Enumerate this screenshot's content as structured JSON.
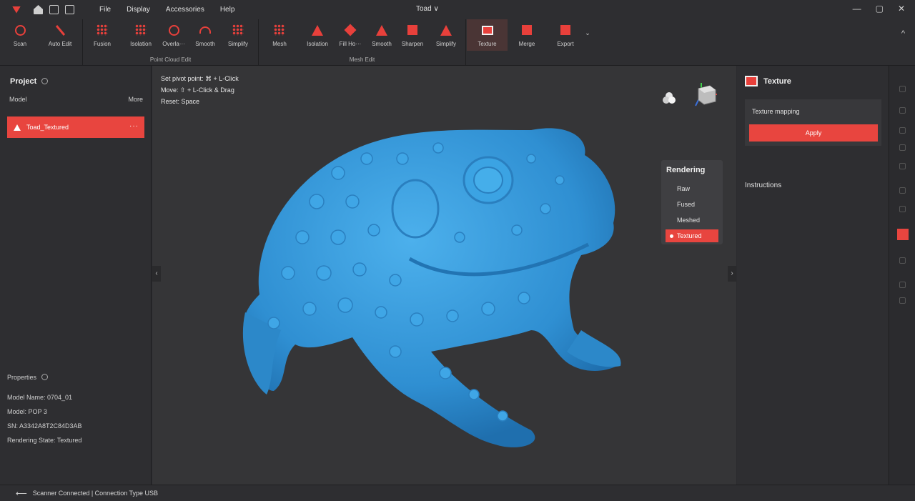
{
  "titlebar": {
    "title": "Toad ∨",
    "menu": [
      "File",
      "Display",
      "Accessories",
      "Help"
    ],
    "window_controls": [
      "—",
      "▢",
      "✕"
    ]
  },
  "ribbon": {
    "scan": {
      "scan_label": "Scan",
      "auto_edit_label": "Auto Edit"
    },
    "point_cloud_edit": {
      "group_label": "Point Cloud Edit",
      "buttons": [
        "Fusion",
        "Isolation",
        "Overla···",
        "Smooth",
        "Simplify"
      ]
    },
    "mesh_edit": {
      "group_label": "Mesh Edit",
      "buttons": [
        "Mesh",
        "Isolation",
        "Fill Ho···",
        "Smooth",
        "Sharpen",
        "Simplify"
      ]
    },
    "tools": {
      "texture_label": "Texture",
      "merge_label": "Merge",
      "export_label": "Export"
    },
    "collapse_icon": "^"
  },
  "project": {
    "title": "Project",
    "model_header": "Model",
    "more_header": "More",
    "models": [
      {
        "name": "Toad_Textured",
        "more": "···"
      }
    ]
  },
  "properties": {
    "title": "Properties",
    "items": [
      "Model Name: 0704_01",
      "Model: POP 3",
      "SN: A3342A8T2C84D3AB",
      "Rendering State: Textured"
    ]
  },
  "viewport": {
    "hints": [
      "Set pivot point: ⌘ + L-Click",
      "Move: ⇧ + L-Click & Drag",
      "Reset: Space"
    ],
    "left_collapse": "‹",
    "right_collapse": "›",
    "model_color": "#3a9ad9"
  },
  "rendering": {
    "title": "Rendering",
    "options": [
      "Raw",
      "Fused",
      "Meshed",
      "Textured"
    ],
    "selected": "Textured"
  },
  "texture_panel": {
    "title": "Texture",
    "card_label": "Texture mapping",
    "apply_label": "Apply",
    "instructions_label": "Instructions"
  },
  "statusbar": {
    "arrow": "⟵",
    "text": "Scanner Connected | Connection Type USB"
  },
  "colors": {
    "accent": "#e8453f",
    "background": "#2b2b2e",
    "panel": "#2e2e31",
    "viewport": "#353537"
  }
}
